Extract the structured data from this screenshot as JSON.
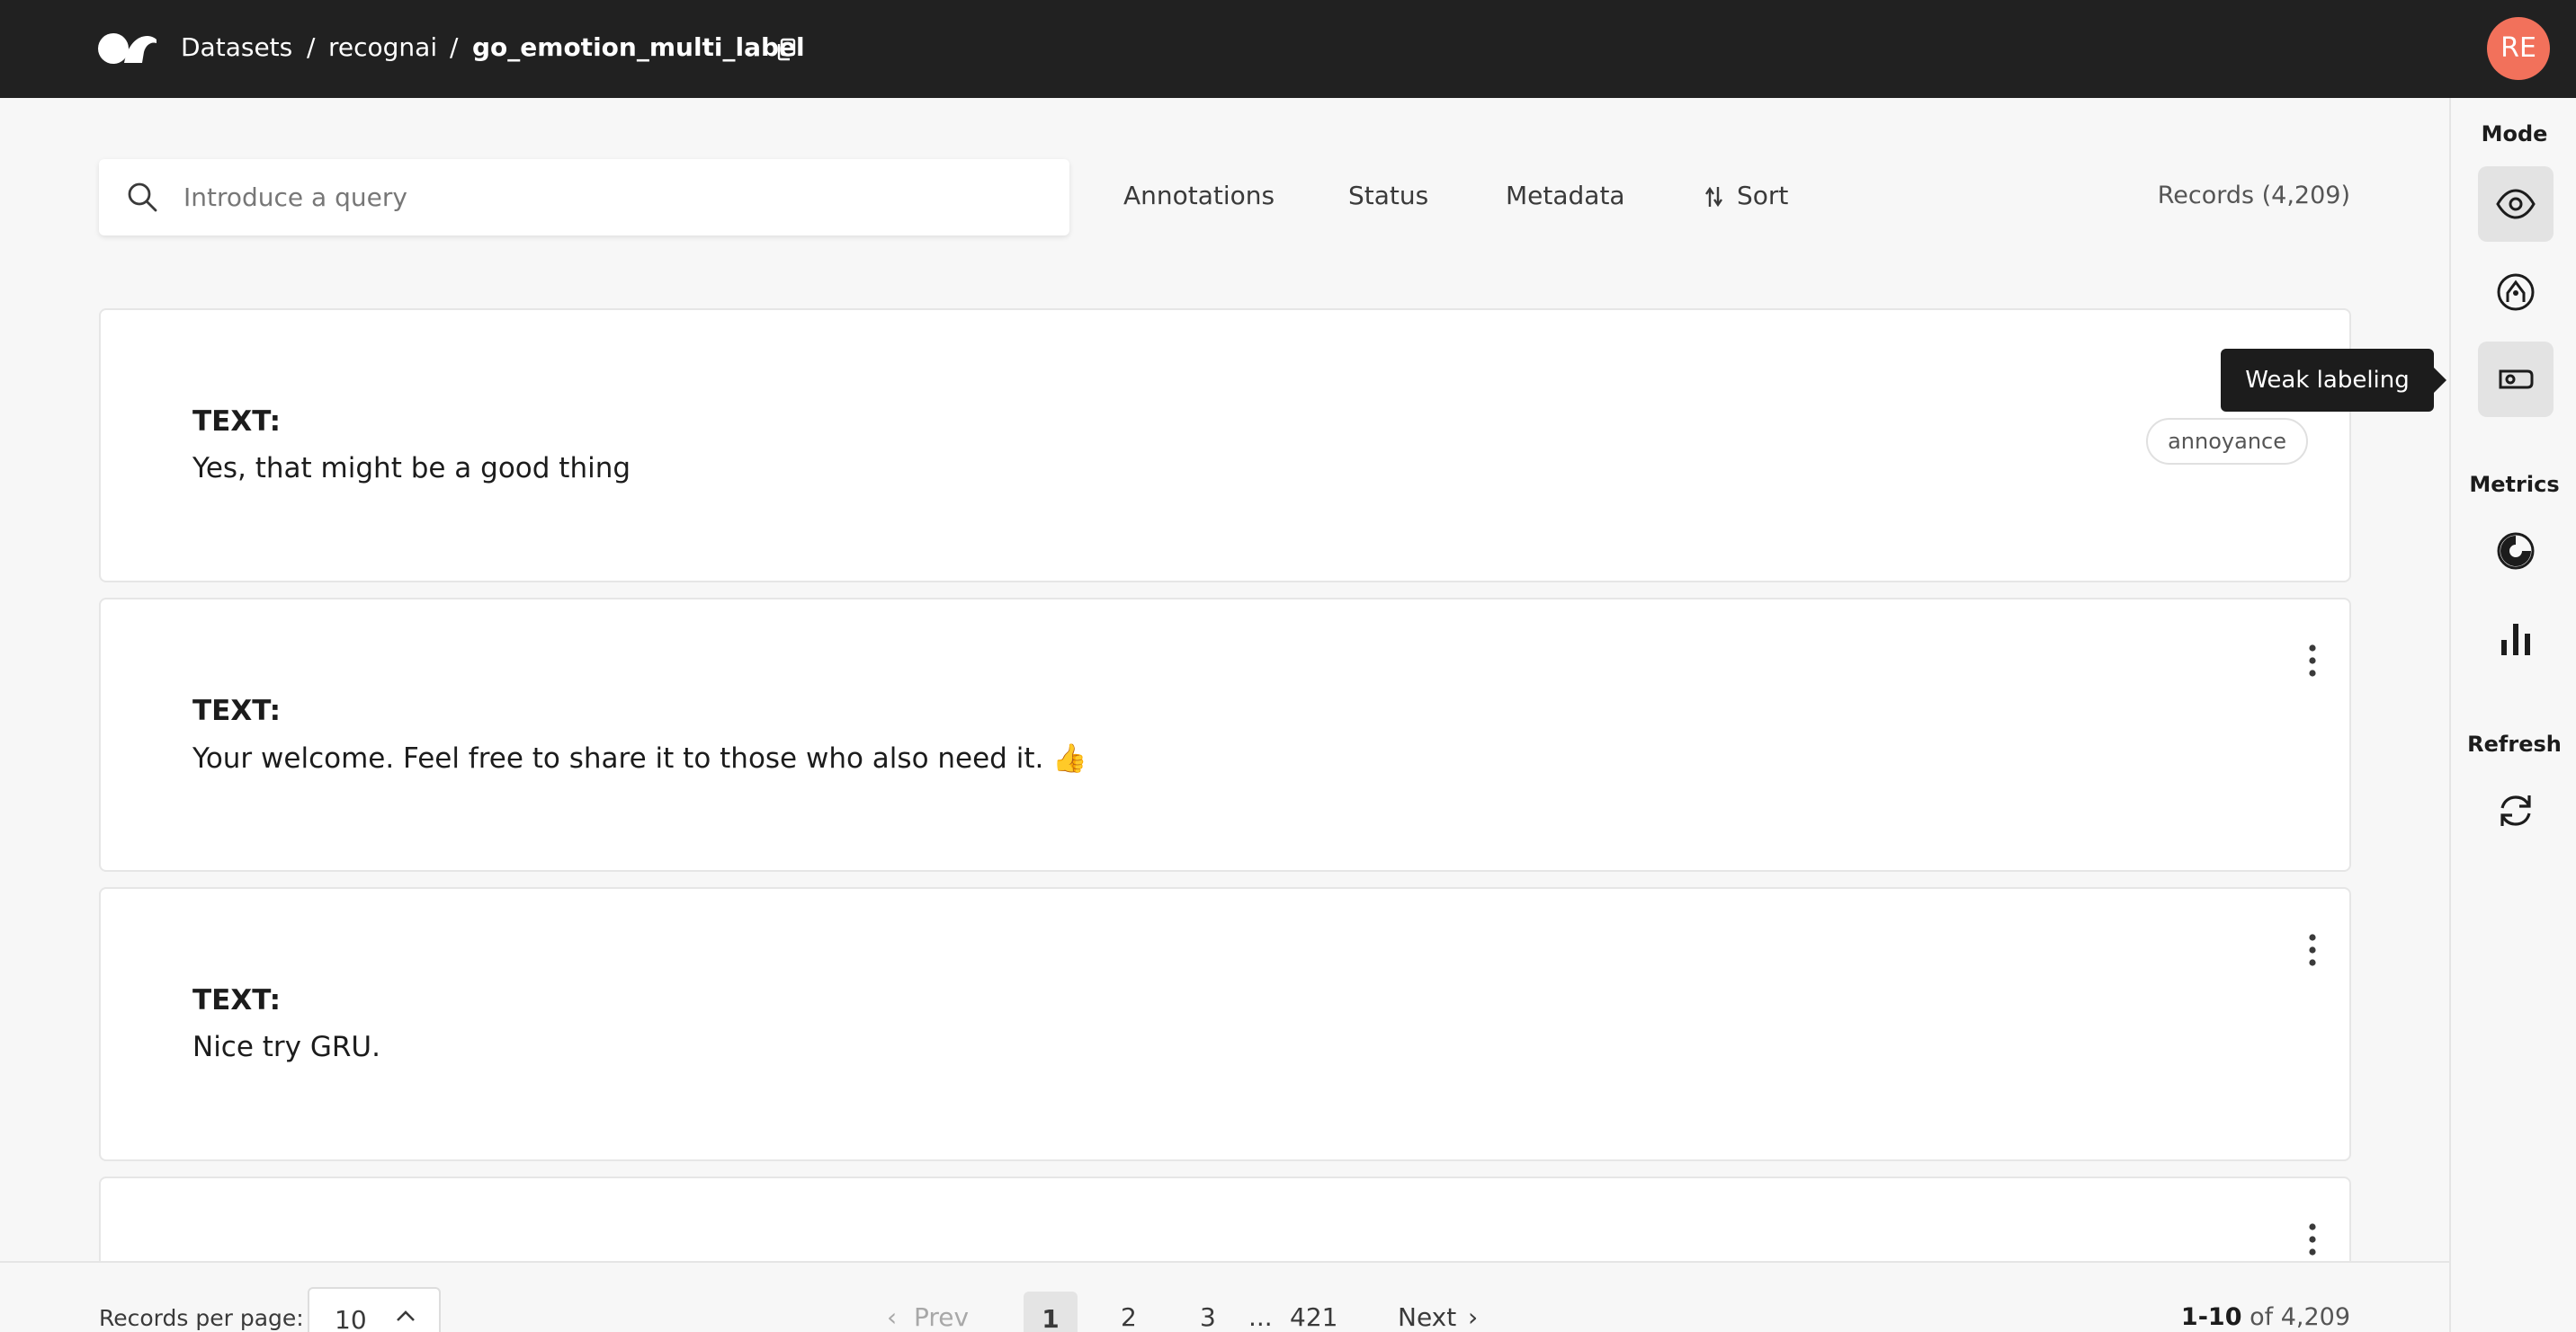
{
  "header": {
    "breadcrumb": [
      "Datasets",
      "recognai",
      "go_emotion_multi_label"
    ],
    "separator": "/",
    "user_initials": "RE",
    "colors": {
      "bar": "#212121",
      "avatar": "#f2715b"
    }
  },
  "search": {
    "placeholder": "Introduce a query",
    "value": ""
  },
  "filters": [
    "Annotations",
    "Status",
    "Metadata",
    "Sort"
  ],
  "records_count": "Records (4,209)",
  "sidebar": {
    "mode_label": "Mode",
    "metrics_label": "Metrics",
    "refresh_label": "Refresh",
    "tooltip": "Weak labeling",
    "icons": [
      "eye-icon",
      "annotate-icon",
      "weak-labeling-icon",
      "progress-icon",
      "bar-chart-icon",
      "refresh-icon"
    ]
  },
  "records": [
    {
      "field": "TEXT:",
      "text": "Yes, that might be a good thing",
      "tags": [
        "annoyance"
      ]
    },
    {
      "field": "TEXT:",
      "text": "Your welcome. Feel free to share it to those who also need it. 👍",
      "tags": []
    },
    {
      "field": "TEXT:",
      "text": "Nice try GRU.",
      "tags": []
    },
    {
      "field": "",
      "text": "",
      "tags": []
    }
  ],
  "pagination": {
    "per_page_label": "Records per page:",
    "per_page": "10",
    "prev": "Prev",
    "next": "Next",
    "pages": [
      "1",
      "2",
      "3",
      "...",
      "421"
    ],
    "current": "1",
    "range_bold": "1-10",
    "range_rest": "of 4,209"
  }
}
